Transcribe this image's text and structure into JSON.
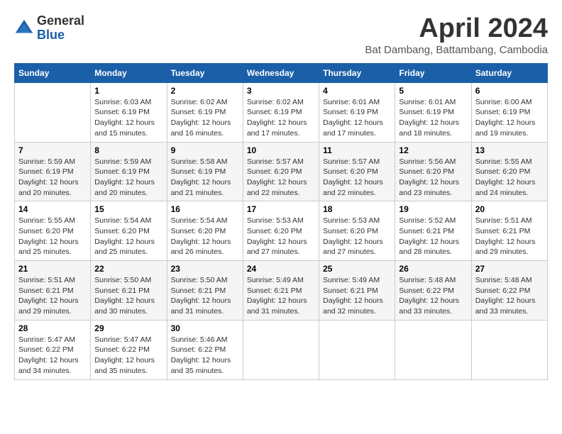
{
  "logo": {
    "general": "General",
    "blue": "Blue"
  },
  "title": "April 2024",
  "location": "Bat Dambang, Battambang, Cambodia",
  "days_of_week": [
    "Sunday",
    "Monday",
    "Tuesday",
    "Wednesday",
    "Thursday",
    "Friday",
    "Saturday"
  ],
  "weeks": [
    [
      {
        "day": "",
        "sunrise": "",
        "sunset": "",
        "daylight": ""
      },
      {
        "day": "1",
        "sunrise": "Sunrise: 6:03 AM",
        "sunset": "Sunset: 6:19 PM",
        "daylight": "Daylight: 12 hours and 15 minutes."
      },
      {
        "day": "2",
        "sunrise": "Sunrise: 6:02 AM",
        "sunset": "Sunset: 6:19 PM",
        "daylight": "Daylight: 12 hours and 16 minutes."
      },
      {
        "day": "3",
        "sunrise": "Sunrise: 6:02 AM",
        "sunset": "Sunset: 6:19 PM",
        "daylight": "Daylight: 12 hours and 17 minutes."
      },
      {
        "day": "4",
        "sunrise": "Sunrise: 6:01 AM",
        "sunset": "Sunset: 6:19 PM",
        "daylight": "Daylight: 12 hours and 17 minutes."
      },
      {
        "day": "5",
        "sunrise": "Sunrise: 6:01 AM",
        "sunset": "Sunset: 6:19 PM",
        "daylight": "Daylight: 12 hours and 18 minutes."
      },
      {
        "day": "6",
        "sunrise": "Sunrise: 6:00 AM",
        "sunset": "Sunset: 6:19 PM",
        "daylight": "Daylight: 12 hours and 19 minutes."
      }
    ],
    [
      {
        "day": "7",
        "sunrise": "Sunrise: 5:59 AM",
        "sunset": "Sunset: 6:19 PM",
        "daylight": "Daylight: 12 hours and 20 minutes."
      },
      {
        "day": "8",
        "sunrise": "Sunrise: 5:59 AM",
        "sunset": "Sunset: 6:19 PM",
        "daylight": "Daylight: 12 hours and 20 minutes."
      },
      {
        "day": "9",
        "sunrise": "Sunrise: 5:58 AM",
        "sunset": "Sunset: 6:19 PM",
        "daylight": "Daylight: 12 hours and 21 minutes."
      },
      {
        "day": "10",
        "sunrise": "Sunrise: 5:57 AM",
        "sunset": "Sunset: 6:20 PM",
        "daylight": "Daylight: 12 hours and 22 minutes."
      },
      {
        "day": "11",
        "sunrise": "Sunrise: 5:57 AM",
        "sunset": "Sunset: 6:20 PM",
        "daylight": "Daylight: 12 hours and 22 minutes."
      },
      {
        "day": "12",
        "sunrise": "Sunrise: 5:56 AM",
        "sunset": "Sunset: 6:20 PM",
        "daylight": "Daylight: 12 hours and 23 minutes."
      },
      {
        "day": "13",
        "sunrise": "Sunrise: 5:55 AM",
        "sunset": "Sunset: 6:20 PM",
        "daylight": "Daylight: 12 hours and 24 minutes."
      }
    ],
    [
      {
        "day": "14",
        "sunrise": "Sunrise: 5:55 AM",
        "sunset": "Sunset: 6:20 PM",
        "daylight": "Daylight: 12 hours and 25 minutes."
      },
      {
        "day": "15",
        "sunrise": "Sunrise: 5:54 AM",
        "sunset": "Sunset: 6:20 PM",
        "daylight": "Daylight: 12 hours and 25 minutes."
      },
      {
        "day": "16",
        "sunrise": "Sunrise: 5:54 AM",
        "sunset": "Sunset: 6:20 PM",
        "daylight": "Daylight: 12 hours and 26 minutes."
      },
      {
        "day": "17",
        "sunrise": "Sunrise: 5:53 AM",
        "sunset": "Sunset: 6:20 PM",
        "daylight": "Daylight: 12 hours and 27 minutes."
      },
      {
        "day": "18",
        "sunrise": "Sunrise: 5:53 AM",
        "sunset": "Sunset: 6:20 PM",
        "daylight": "Daylight: 12 hours and 27 minutes."
      },
      {
        "day": "19",
        "sunrise": "Sunrise: 5:52 AM",
        "sunset": "Sunset: 6:21 PM",
        "daylight": "Daylight: 12 hours and 28 minutes."
      },
      {
        "day": "20",
        "sunrise": "Sunrise: 5:51 AM",
        "sunset": "Sunset: 6:21 PM",
        "daylight": "Daylight: 12 hours and 29 minutes."
      }
    ],
    [
      {
        "day": "21",
        "sunrise": "Sunrise: 5:51 AM",
        "sunset": "Sunset: 6:21 PM",
        "daylight": "Daylight: 12 hours and 29 minutes."
      },
      {
        "day": "22",
        "sunrise": "Sunrise: 5:50 AM",
        "sunset": "Sunset: 6:21 PM",
        "daylight": "Daylight: 12 hours and 30 minutes."
      },
      {
        "day": "23",
        "sunrise": "Sunrise: 5:50 AM",
        "sunset": "Sunset: 6:21 PM",
        "daylight": "Daylight: 12 hours and 31 minutes."
      },
      {
        "day": "24",
        "sunrise": "Sunrise: 5:49 AM",
        "sunset": "Sunset: 6:21 PM",
        "daylight": "Daylight: 12 hours and 31 minutes."
      },
      {
        "day": "25",
        "sunrise": "Sunrise: 5:49 AM",
        "sunset": "Sunset: 6:21 PM",
        "daylight": "Daylight: 12 hours and 32 minutes."
      },
      {
        "day": "26",
        "sunrise": "Sunrise: 5:48 AM",
        "sunset": "Sunset: 6:22 PM",
        "daylight": "Daylight: 12 hours and 33 minutes."
      },
      {
        "day": "27",
        "sunrise": "Sunrise: 5:48 AM",
        "sunset": "Sunset: 6:22 PM",
        "daylight": "Daylight: 12 hours and 33 minutes."
      }
    ],
    [
      {
        "day": "28",
        "sunrise": "Sunrise: 5:47 AM",
        "sunset": "Sunset: 6:22 PM",
        "daylight": "Daylight: 12 hours and 34 minutes."
      },
      {
        "day": "29",
        "sunrise": "Sunrise: 5:47 AM",
        "sunset": "Sunset: 6:22 PM",
        "daylight": "Daylight: 12 hours and 35 minutes."
      },
      {
        "day": "30",
        "sunrise": "Sunrise: 5:46 AM",
        "sunset": "Sunset: 6:22 PM",
        "daylight": "Daylight: 12 hours and 35 minutes."
      },
      {
        "day": "",
        "sunrise": "",
        "sunset": "",
        "daylight": ""
      },
      {
        "day": "",
        "sunrise": "",
        "sunset": "",
        "daylight": ""
      },
      {
        "day": "",
        "sunrise": "",
        "sunset": "",
        "daylight": ""
      },
      {
        "day": "",
        "sunrise": "",
        "sunset": "",
        "daylight": ""
      }
    ]
  ]
}
